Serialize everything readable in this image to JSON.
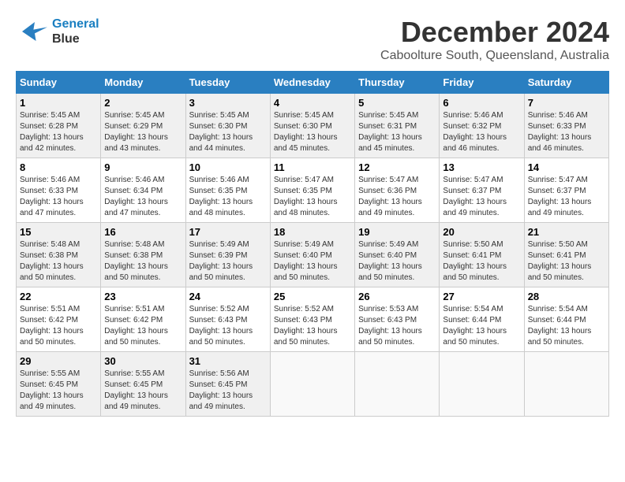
{
  "header": {
    "logo_line1": "General",
    "logo_line2": "Blue",
    "month": "December 2024",
    "location": "Caboolture South, Queensland, Australia"
  },
  "weekdays": [
    "Sunday",
    "Monday",
    "Tuesday",
    "Wednesday",
    "Thursday",
    "Friday",
    "Saturday"
  ],
  "weeks": [
    [
      {
        "day": "1",
        "sunrise": "5:45 AM",
        "sunset": "6:28 PM",
        "daylight": "13 hours and 42 minutes."
      },
      {
        "day": "2",
        "sunrise": "5:45 AM",
        "sunset": "6:29 PM",
        "daylight": "13 hours and 43 minutes."
      },
      {
        "day": "3",
        "sunrise": "5:45 AM",
        "sunset": "6:30 PM",
        "daylight": "13 hours and 44 minutes."
      },
      {
        "day": "4",
        "sunrise": "5:45 AM",
        "sunset": "6:30 PM",
        "daylight": "13 hours and 45 minutes."
      },
      {
        "day": "5",
        "sunrise": "5:45 AM",
        "sunset": "6:31 PM",
        "daylight": "13 hours and 45 minutes."
      },
      {
        "day": "6",
        "sunrise": "5:46 AM",
        "sunset": "6:32 PM",
        "daylight": "13 hours and 46 minutes."
      },
      {
        "day": "7",
        "sunrise": "5:46 AM",
        "sunset": "6:33 PM",
        "daylight": "13 hours and 46 minutes."
      }
    ],
    [
      {
        "day": "8",
        "sunrise": "5:46 AM",
        "sunset": "6:33 PM",
        "daylight": "13 hours and 47 minutes."
      },
      {
        "day": "9",
        "sunrise": "5:46 AM",
        "sunset": "6:34 PM",
        "daylight": "13 hours and 47 minutes."
      },
      {
        "day": "10",
        "sunrise": "5:46 AM",
        "sunset": "6:35 PM",
        "daylight": "13 hours and 48 minutes."
      },
      {
        "day": "11",
        "sunrise": "5:47 AM",
        "sunset": "6:35 PM",
        "daylight": "13 hours and 48 minutes."
      },
      {
        "day": "12",
        "sunrise": "5:47 AM",
        "sunset": "6:36 PM",
        "daylight": "13 hours and 49 minutes."
      },
      {
        "day": "13",
        "sunrise": "5:47 AM",
        "sunset": "6:37 PM",
        "daylight": "13 hours and 49 minutes."
      },
      {
        "day": "14",
        "sunrise": "5:47 AM",
        "sunset": "6:37 PM",
        "daylight": "13 hours and 49 minutes."
      }
    ],
    [
      {
        "day": "15",
        "sunrise": "5:48 AM",
        "sunset": "6:38 PM",
        "daylight": "13 hours and 50 minutes."
      },
      {
        "day": "16",
        "sunrise": "5:48 AM",
        "sunset": "6:38 PM",
        "daylight": "13 hours and 50 minutes."
      },
      {
        "day": "17",
        "sunrise": "5:49 AM",
        "sunset": "6:39 PM",
        "daylight": "13 hours and 50 minutes."
      },
      {
        "day": "18",
        "sunrise": "5:49 AM",
        "sunset": "6:40 PM",
        "daylight": "13 hours and 50 minutes."
      },
      {
        "day": "19",
        "sunrise": "5:49 AM",
        "sunset": "6:40 PM",
        "daylight": "13 hours and 50 minutes."
      },
      {
        "day": "20",
        "sunrise": "5:50 AM",
        "sunset": "6:41 PM",
        "daylight": "13 hours and 50 minutes."
      },
      {
        "day": "21",
        "sunrise": "5:50 AM",
        "sunset": "6:41 PM",
        "daylight": "13 hours and 50 minutes."
      }
    ],
    [
      {
        "day": "22",
        "sunrise": "5:51 AM",
        "sunset": "6:42 PM",
        "daylight": "13 hours and 50 minutes."
      },
      {
        "day": "23",
        "sunrise": "5:51 AM",
        "sunset": "6:42 PM",
        "daylight": "13 hours and 50 minutes."
      },
      {
        "day": "24",
        "sunrise": "5:52 AM",
        "sunset": "6:43 PM",
        "daylight": "13 hours and 50 minutes."
      },
      {
        "day": "25",
        "sunrise": "5:52 AM",
        "sunset": "6:43 PM",
        "daylight": "13 hours and 50 minutes."
      },
      {
        "day": "26",
        "sunrise": "5:53 AM",
        "sunset": "6:43 PM",
        "daylight": "13 hours and 50 minutes."
      },
      {
        "day": "27",
        "sunrise": "5:54 AM",
        "sunset": "6:44 PM",
        "daylight": "13 hours and 50 minutes."
      },
      {
        "day": "28",
        "sunrise": "5:54 AM",
        "sunset": "6:44 PM",
        "daylight": "13 hours and 50 minutes."
      }
    ],
    [
      {
        "day": "29",
        "sunrise": "5:55 AM",
        "sunset": "6:45 PM",
        "daylight": "13 hours and 49 minutes."
      },
      {
        "day": "30",
        "sunrise": "5:55 AM",
        "sunset": "6:45 PM",
        "daylight": "13 hours and 49 minutes."
      },
      {
        "day": "31",
        "sunrise": "5:56 AM",
        "sunset": "6:45 PM",
        "daylight": "13 hours and 49 minutes."
      },
      null,
      null,
      null,
      null
    ]
  ]
}
